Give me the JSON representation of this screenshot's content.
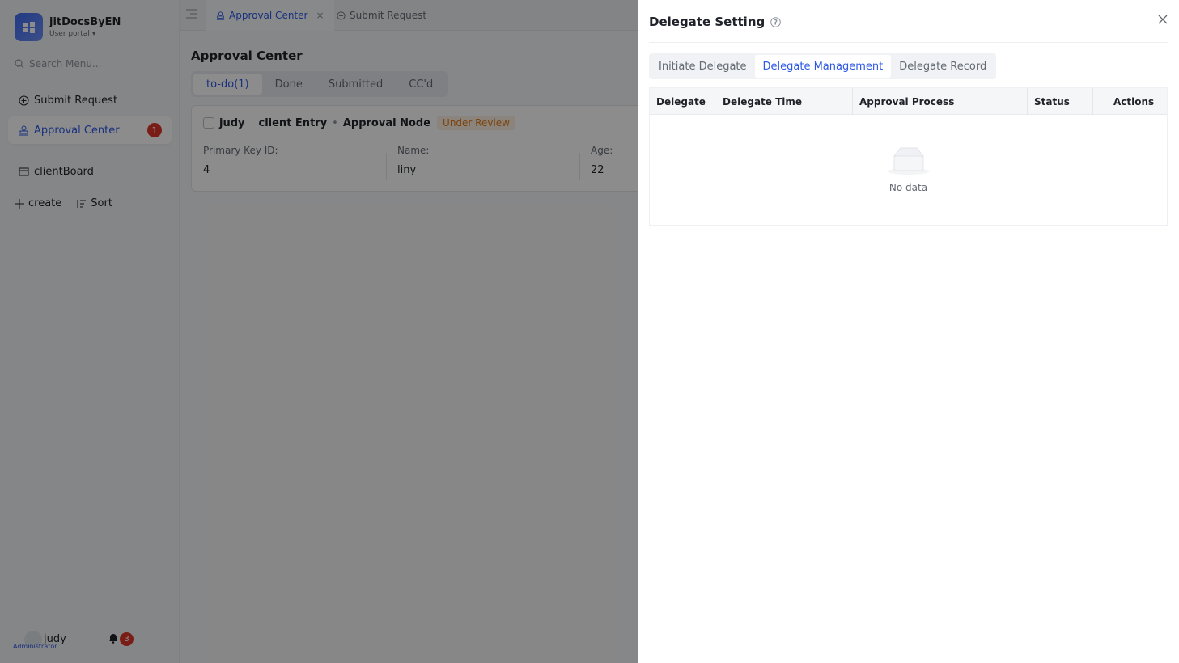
{
  "app": {
    "title": "jitDocsByEN",
    "subtitle": "User portal"
  },
  "sidebar": {
    "search_placeholder": "Search Menu...",
    "items": [
      {
        "label": "Submit Request",
        "icon": "plus-circle-icon"
      },
      {
        "label": "Approval Center",
        "icon": "stamp-icon",
        "badge": "1",
        "active": true
      },
      {
        "label": "clientBoard",
        "icon": "board-icon"
      }
    ],
    "tools": {
      "create": "create",
      "sort": "Sort"
    },
    "user": {
      "name": "judy",
      "role": "Administrator",
      "notifications": "3"
    }
  },
  "topbar": {
    "tabs": [
      {
        "label": "Approval Center",
        "active": true
      },
      {
        "label": "Submit Request"
      }
    ]
  },
  "main": {
    "title": "Approval Center",
    "segments": [
      "to-do(1)",
      "Done",
      "Submitted",
      "CC'd"
    ],
    "card": {
      "user": "judy",
      "form": "client Entry",
      "node": "Approval Node",
      "status": "Under Review",
      "fields": [
        {
          "label": "Primary Key ID:",
          "value": "4"
        },
        {
          "label": "Name:",
          "value": "liny"
        },
        {
          "label": "Age:",
          "value": "22"
        }
      ]
    }
  },
  "drawer": {
    "title": "Delegate Setting",
    "tabs": [
      "Initiate Delegate",
      "Delegate Management",
      "Delegate Record"
    ],
    "active_tab": "Delegate Management",
    "columns": [
      "Delegate",
      "Delegate Time",
      "Approval Process",
      "Status",
      "Actions"
    ],
    "empty_text": "No data"
  },
  "colors": {
    "accent": "#2e59e6",
    "badge": "#e0352b",
    "review": "#e07b17"
  }
}
